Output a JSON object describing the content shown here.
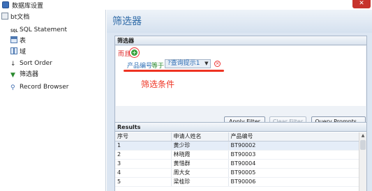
{
  "window": {
    "title": "数据库设置",
    "close_glyph": "✕"
  },
  "sidebar": {
    "items": [
      {
        "label": "bt文档",
        "icon": "database-icon"
      },
      {
        "label": "SQL Statement",
        "icon": "sql-icon"
      },
      {
        "label": "表",
        "icon": "table-icon"
      },
      {
        "label": "域",
        "icon": "field-icon"
      },
      {
        "label": "Sort Order",
        "icon": "sort-icon"
      },
      {
        "label": "筛选器",
        "icon": "filter-icon"
      },
      {
        "label": "Record Browser",
        "icon": "browse-icon"
      }
    ]
  },
  "main": {
    "title": "筛选器",
    "filter_panel": {
      "header": "筛选器",
      "and_label": "而且",
      "condition": {
        "field": "产品编号",
        "operator": "等于",
        "value": "?查询提示1"
      },
      "annotation": "筛选条件"
    },
    "buttons": {
      "apply": "Apply Filter",
      "clear": "Clear Filter",
      "query": "Query Prompts..."
    },
    "results": {
      "header": "Results",
      "columns": [
        "序号",
        "申请人姓名",
        "产品编号"
      ],
      "rows": [
        [
          "1",
          "黄少珍",
          "BT90002"
        ],
        [
          "2",
          "林晓霞",
          "BT90003"
        ],
        [
          "3",
          "黄惜群",
          "BT90004"
        ],
        [
          "4",
          "周大女",
          "BT90005"
        ],
        [
          "5",
          "梁桂珍",
          "BT90006"
        ]
      ]
    }
  },
  "colors": {
    "accent": "#2e6aa7",
    "annotation": "#e33322",
    "and_plus": "#3aa33f",
    "close": "#c7322b"
  }
}
